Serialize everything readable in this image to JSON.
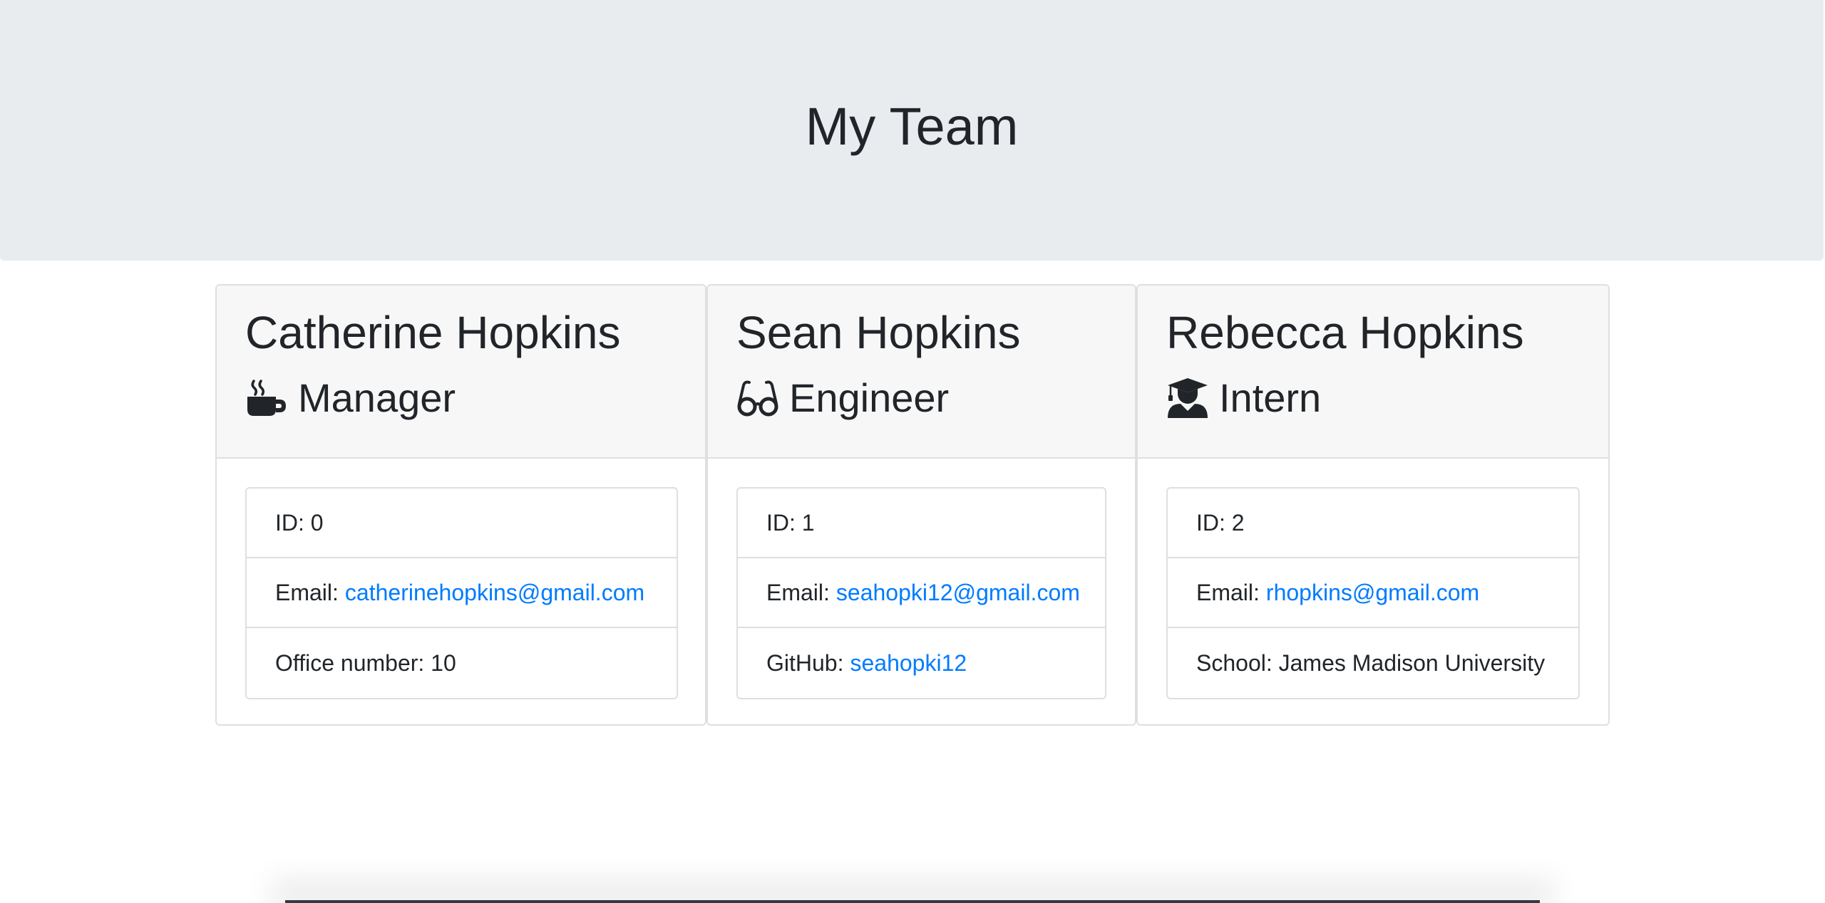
{
  "header": {
    "title": "My Team"
  },
  "team": [
    {
      "name": "Catherine Hopkins",
      "role": "Manager",
      "role_icon": "coffee-mug-icon",
      "id_label": "ID: 0",
      "email_label": "Email:",
      "email": "catherinehopkins@gmail.com",
      "extra_label": "Office number: 10",
      "extra_link": ""
    },
    {
      "name": "Sean Hopkins",
      "role": "Engineer",
      "role_icon": "glasses-icon",
      "id_label": "ID: 1",
      "email_label": "Email:",
      "email": "seahopki12@gmail.com",
      "extra_label": "GitHub:",
      "extra_link": "seahopki12"
    },
    {
      "name": "Rebecca Hopkins",
      "role": "Intern",
      "role_icon": "graduate-icon",
      "id_label": "ID: 2",
      "email_label": "Email:",
      "email": "rhopkins@gmail.com",
      "extra_label": "School: James Madison University",
      "extra_link": ""
    }
  ],
  "colors": {
    "header_bg": "#e9ecef",
    "card_header_bg": "#f7f7f7",
    "link": "#007bff",
    "text": "#212529"
  }
}
